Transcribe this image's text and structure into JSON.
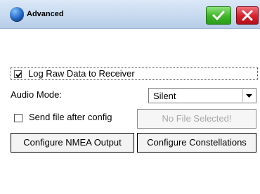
{
  "window": {
    "title": "Advanced",
    "icon": "globe-icon",
    "ok_icon": "checkmark-icon",
    "close_icon": "close-x-icon",
    "accent_ok": "#3fb52a",
    "accent_close": "#d81e2b"
  },
  "log_raw": {
    "label": "Log Raw Data to Receiver",
    "checked": true
  },
  "audio_mode": {
    "label": "Audio Mode:",
    "value": "Silent"
  },
  "send_file": {
    "label": "Send file after config",
    "checked": false,
    "file_button": "No File Selected!"
  },
  "buttons": {
    "nmea": "Configure NMEA Output",
    "constellations": "Configure Constellations"
  }
}
